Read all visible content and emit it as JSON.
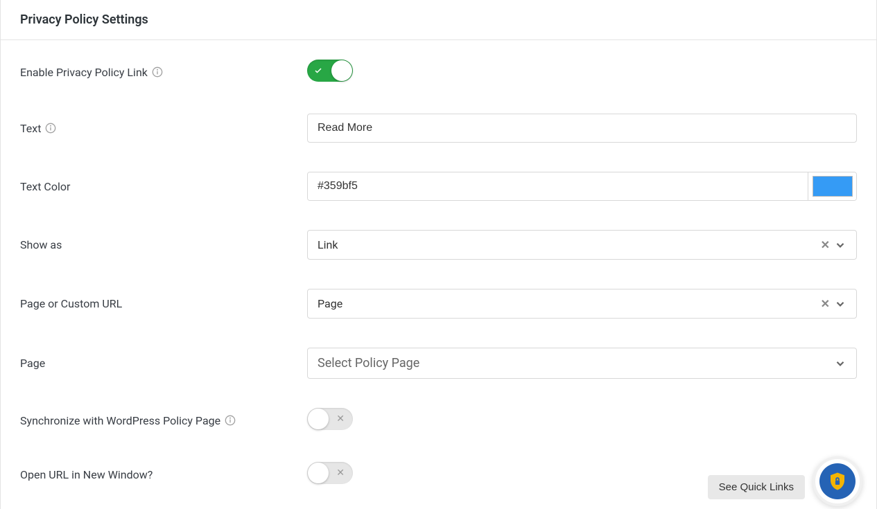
{
  "header": {
    "title": "Privacy Policy Settings"
  },
  "fields": {
    "enable": {
      "label": "Enable Privacy Policy Link",
      "value": true
    },
    "text": {
      "label": "Text",
      "value": "Read More"
    },
    "text_color": {
      "label": "Text Color",
      "value": "#359bf5",
      "swatch": "#359bf5"
    },
    "show_as": {
      "label": "Show as",
      "value": "Link"
    },
    "page_or_url": {
      "label": "Page or Custom URL",
      "value": "Page"
    },
    "page": {
      "label": "Page",
      "placeholder": "Select Policy Page"
    },
    "sync_wp": {
      "label": "Synchronize with WordPress Policy Page",
      "value": false
    },
    "new_window": {
      "label": "Open URL in New Window?",
      "value": false
    }
  },
  "footer": {
    "quick_links": "See Quick Links"
  }
}
